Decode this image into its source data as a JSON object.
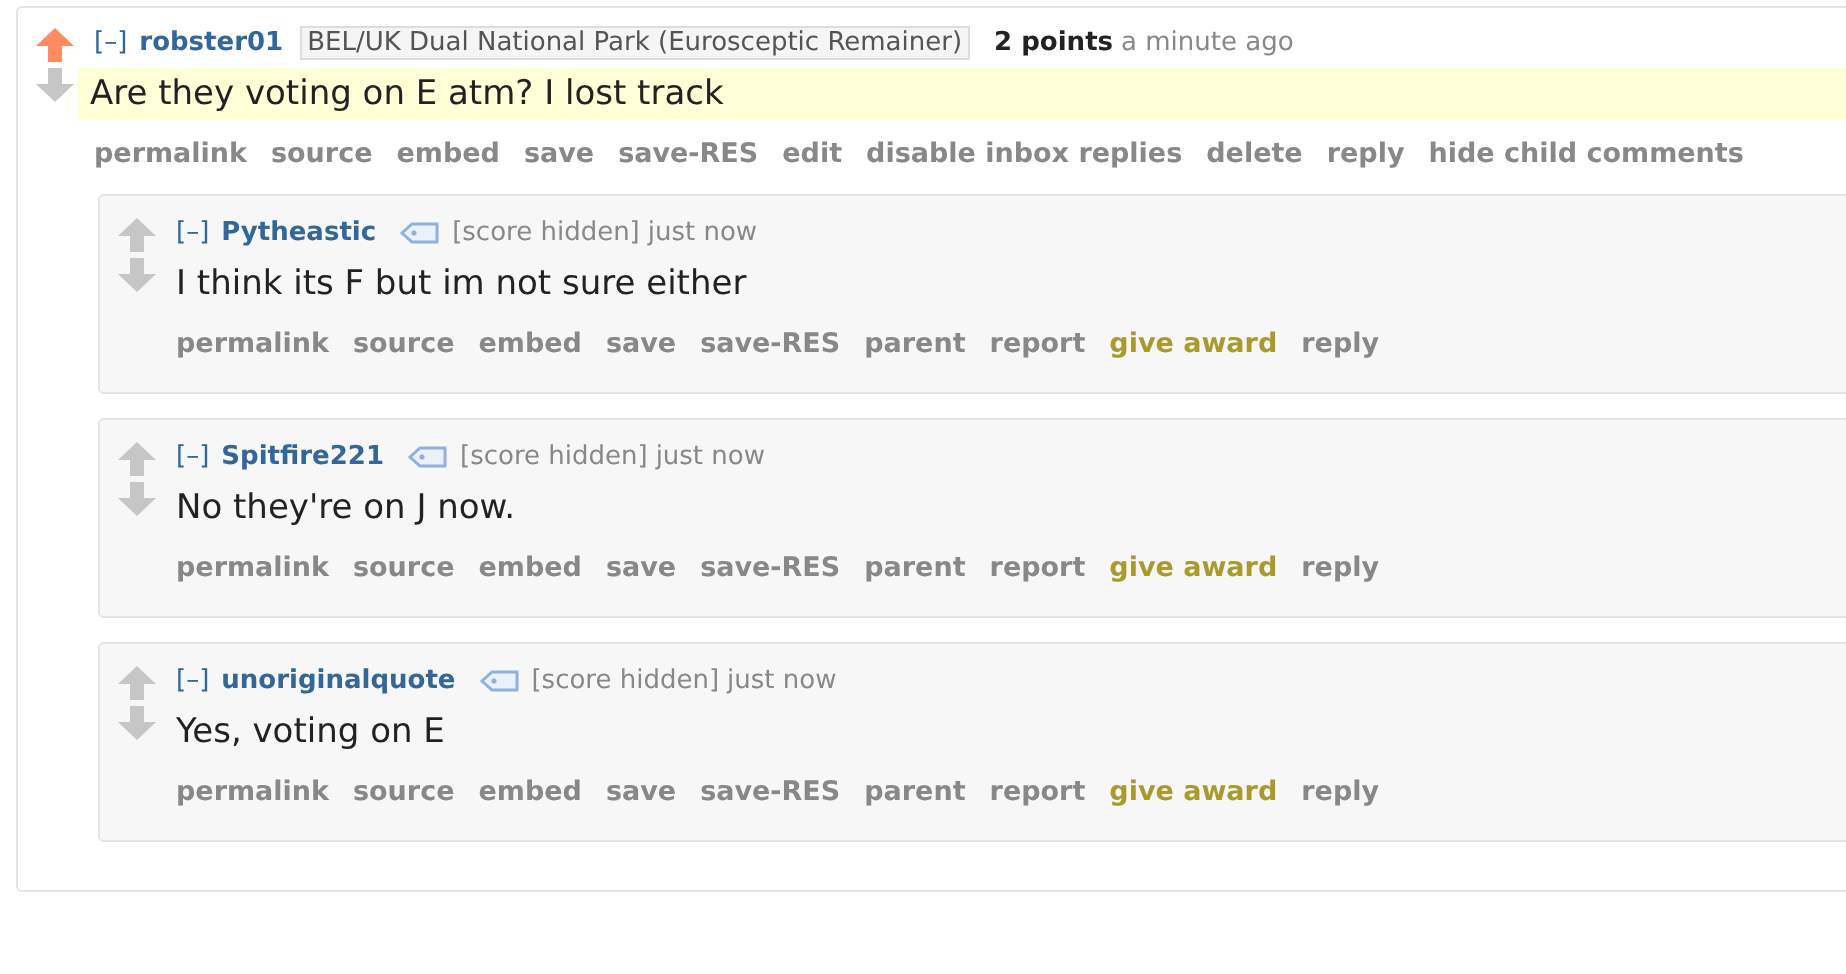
{
  "comment": {
    "collapse": "[–]",
    "author": "robster01",
    "flair": "BEL/UK Dual National Park (Eurosceptic Remainer)",
    "score": "2 points",
    "score_hidden": false,
    "time": "a minute ago",
    "body": "Are they voting on E atm? I lost track",
    "upvoted": true,
    "highlighted": true,
    "actions": [
      {
        "label": "permalink",
        "kind": "link"
      },
      {
        "label": "source",
        "kind": "link"
      },
      {
        "label": "embed",
        "kind": "link"
      },
      {
        "label": "save",
        "kind": "link"
      },
      {
        "label": "save-RES",
        "kind": "link"
      },
      {
        "label": "edit",
        "kind": "link"
      },
      {
        "label": "disable inbox replies",
        "kind": "link"
      },
      {
        "label": "delete",
        "kind": "link"
      },
      {
        "label": "reply",
        "kind": "link"
      },
      {
        "label": "hide child comments",
        "kind": "link"
      }
    ],
    "children": [
      {
        "collapse": "[–]",
        "author": "Pytheastic",
        "score": "[score hidden]",
        "score_hidden": true,
        "time": "just now",
        "body": "I think its F but im not sure either",
        "upvoted": false,
        "highlighted": false,
        "actions": [
          {
            "label": "permalink",
            "kind": "link"
          },
          {
            "label": "source",
            "kind": "link"
          },
          {
            "label": "embed",
            "kind": "link"
          },
          {
            "label": "save",
            "kind": "link"
          },
          {
            "label": "save-RES",
            "kind": "link"
          },
          {
            "label": "parent",
            "kind": "link"
          },
          {
            "label": "report",
            "kind": "link"
          },
          {
            "label": "give award",
            "kind": "award"
          },
          {
            "label": "reply",
            "kind": "link"
          }
        ]
      },
      {
        "collapse": "[–]",
        "author": "Spitfire221",
        "score": "[score hidden]",
        "score_hidden": true,
        "time": "just now",
        "body": "No they're on J now.",
        "upvoted": false,
        "highlighted": false,
        "actions": [
          {
            "label": "permalink",
            "kind": "link"
          },
          {
            "label": "source",
            "kind": "link"
          },
          {
            "label": "embed",
            "kind": "link"
          },
          {
            "label": "save",
            "kind": "link"
          },
          {
            "label": "save-RES",
            "kind": "link"
          },
          {
            "label": "parent",
            "kind": "link"
          },
          {
            "label": "report",
            "kind": "link"
          },
          {
            "label": "give award",
            "kind": "award"
          },
          {
            "label": "reply",
            "kind": "link"
          }
        ]
      },
      {
        "collapse": "[–]",
        "author": "unoriginalquote",
        "score": "[score hidden]",
        "score_hidden": true,
        "time": "just now",
        "body": "Yes, voting on E",
        "upvoted": false,
        "highlighted": false,
        "actions": [
          {
            "label": "permalink",
            "kind": "link"
          },
          {
            "label": "source",
            "kind": "link"
          },
          {
            "label": "embed",
            "kind": "link"
          },
          {
            "label": "save",
            "kind": "link"
          },
          {
            "label": "save-RES",
            "kind": "link"
          },
          {
            "label": "parent",
            "kind": "link"
          },
          {
            "label": "report",
            "kind": "link"
          },
          {
            "label": "give award",
            "kind": "award"
          },
          {
            "label": "reply",
            "kind": "link"
          }
        ]
      }
    ]
  }
}
